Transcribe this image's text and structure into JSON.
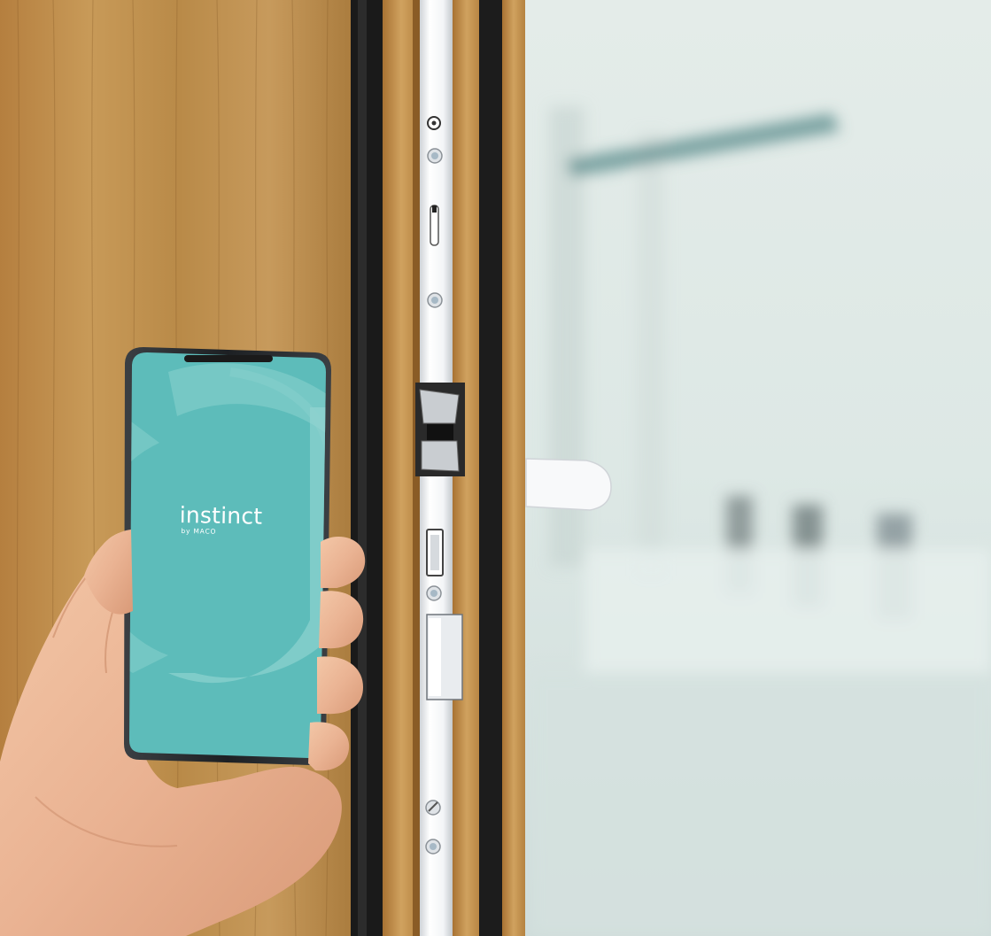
{
  "image": {
    "description_role": "product photo",
    "colors": {
      "wood": "#b98a44",
      "phone_screen": "#5dbcba",
      "lock_plate": "#f2f4f6",
      "background": "#dfe9e6"
    }
  },
  "phone": {
    "app_name": "instinct",
    "app_tagline": "by MACO"
  }
}
